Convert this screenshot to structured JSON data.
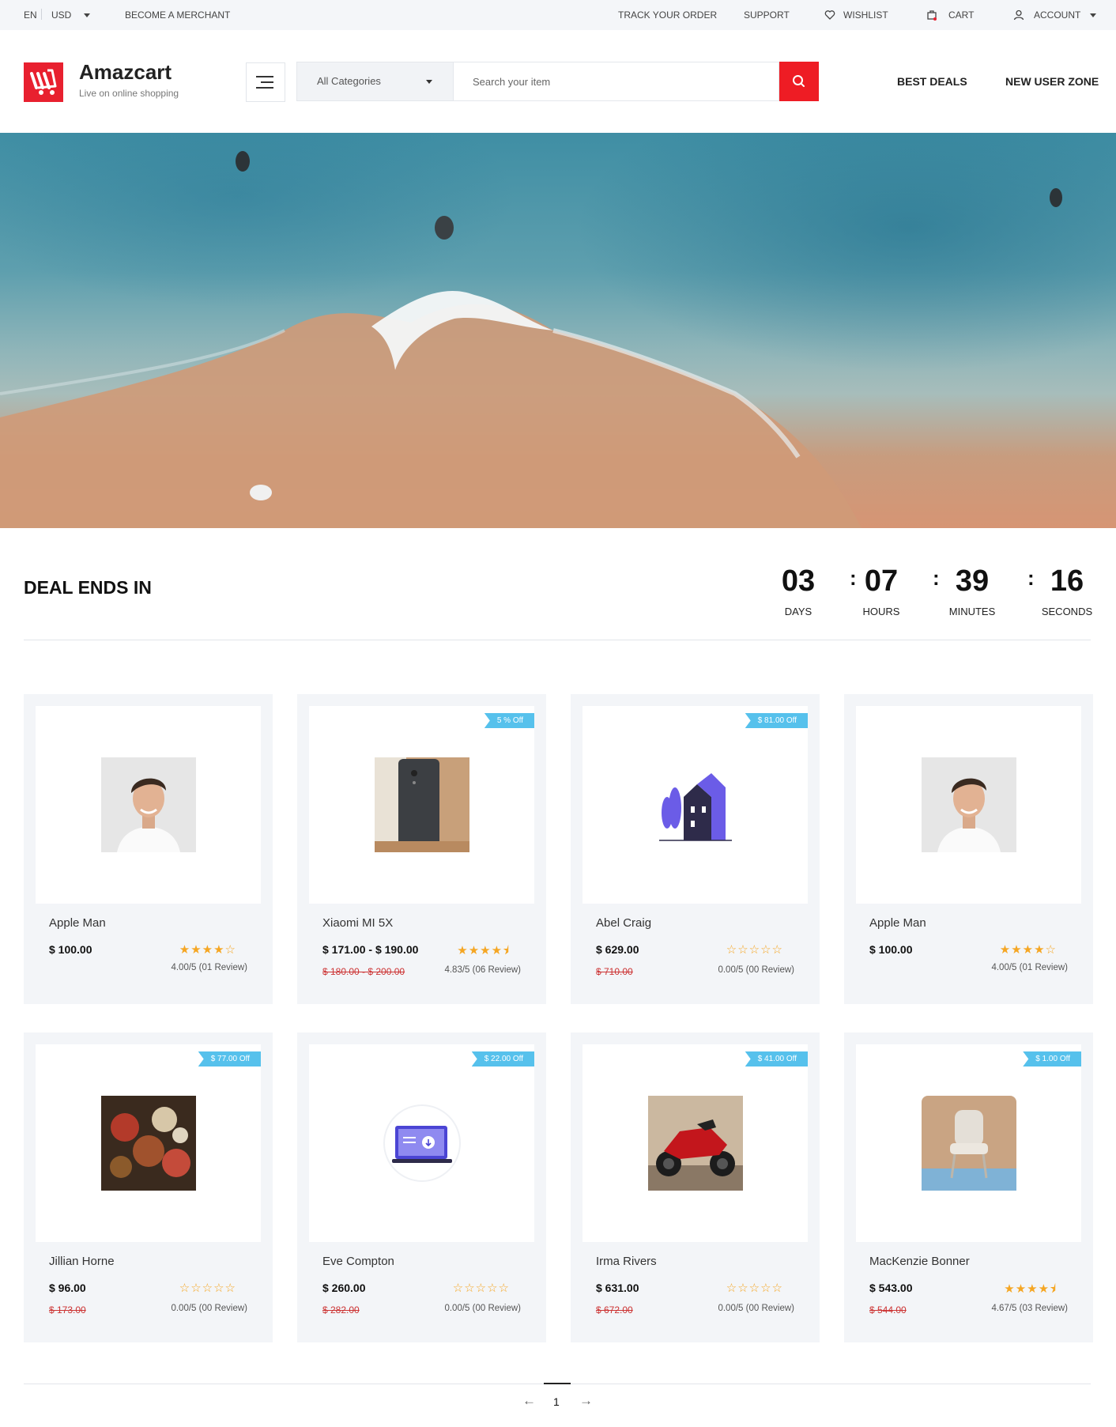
{
  "topbar": {
    "language": "EN",
    "currency": "USD",
    "merchant": "BECOME A MERCHANT",
    "track": "TRACK YOUR ORDER",
    "support": "SUPPORT",
    "wishlist": "WISHLIST",
    "cart": "CART",
    "account": "ACCOUNT"
  },
  "header": {
    "brand": "Amazcart",
    "tagline": "Live on online shopping",
    "category": "All Categories",
    "search_placeholder": "Search your item",
    "best_deals": "BEST DEALS",
    "new_user_zone": "NEW USER ZONE"
  },
  "deal": {
    "title": "DEAL ENDS IN",
    "countdown": [
      {
        "value": "03",
        "label": "DAYS"
      },
      {
        "value": "07",
        "label": "HOURS"
      },
      {
        "value": "39",
        "label": "MINUTES"
      },
      {
        "value": "16",
        "label": "SECONDS"
      }
    ]
  },
  "products": [
    {
      "name": "Apple Man",
      "price": "$ 100.00",
      "old_price": "",
      "badge": "",
      "rating": 4,
      "review": "4.00/5 (01 Review)",
      "image": "man-photo"
    },
    {
      "name": "Xiaomi MI 5X",
      "price": "$ 171.00 - $ 190.00",
      "old_price": "$ 180.00 - $ 200.00",
      "badge": "5 % Off",
      "rating": 4.5,
      "review": "4.83/5 (06 Review)",
      "image": "phone-photo"
    },
    {
      "name": "Abel Craig",
      "price": "$ 629.00",
      "old_price": "$ 710.00",
      "badge": "$ 81.00 Off",
      "rating": 0,
      "review": "0.00/5 (00 Review)",
      "image": "house-illustration"
    },
    {
      "name": "Apple Man",
      "price": "$ 100.00",
      "old_price": "",
      "badge": "",
      "rating": 4,
      "review": "4.00/5 (01 Review)",
      "image": "man-photo"
    },
    {
      "name": "Jillian Horne",
      "price": "$ 96.00",
      "old_price": "$ 173.00",
      "badge": "$ 77.00 Off",
      "rating": 0,
      "review": "0.00/5 (00 Review)",
      "image": "food-photo"
    },
    {
      "name": "Eve Compton",
      "price": "$ 260.00",
      "old_price": "$ 282.00",
      "badge": "$ 22.00 Off",
      "rating": 0,
      "review": "0.00/5 (00 Review)",
      "image": "laptop-illustration"
    },
    {
      "name": "Irma Rivers",
      "price": "$ 631.00",
      "old_price": "$ 672.00",
      "badge": "$ 41.00 Off",
      "rating": 0,
      "review": "0.00/5 (00 Review)",
      "image": "motorcycle-photo"
    },
    {
      "name": "MacKenzie Bonner",
      "price": "$ 543.00",
      "old_price": "$ 544.00",
      "badge": "$ 1.00 Off",
      "rating": 4.5,
      "review": "4.67/5 (03 Review)",
      "image": "chair-photo"
    }
  ],
  "pagination": {
    "current": "1"
  },
  "colors": {
    "accent": "#ee1c24",
    "badge": "#56c1ec",
    "star": "#f5a623",
    "card_bg": "#f3f5f8"
  }
}
